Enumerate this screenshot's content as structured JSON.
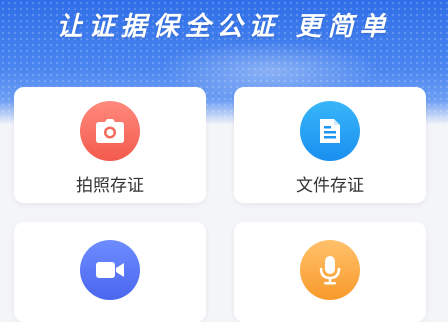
{
  "banner": {
    "slogan": "让证据保全公证 更简单"
  },
  "features": [
    {
      "label": "拍照存证",
      "icon": "camera-icon",
      "color": "#f25a4c"
    },
    {
      "label": "文件存证",
      "icon": "document-icon",
      "color": "#1a8ff0"
    },
    {
      "label": "",
      "icon": "video-camera-icon",
      "color": "#4a66ee"
    },
    {
      "label": "",
      "icon": "microphone-icon",
      "color": "#f89a2c"
    }
  ]
}
